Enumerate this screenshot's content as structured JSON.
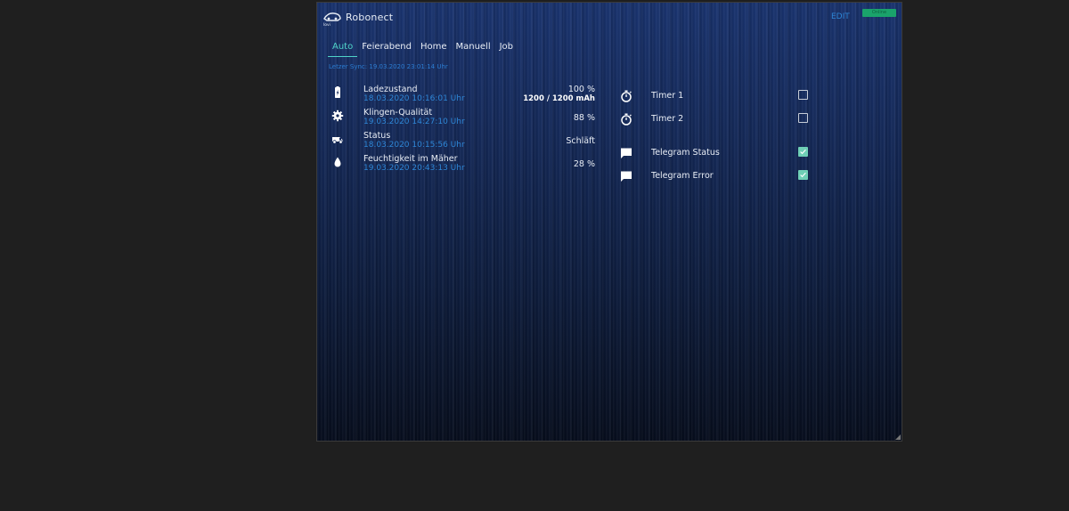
{
  "app": {
    "title": "Robonect",
    "logo_text": "lovi",
    "edit_label": "EDIT",
    "status_label": "Online",
    "status_color": "#1aa36b"
  },
  "tabs": [
    {
      "label": "Auto",
      "active": true
    },
    {
      "label": "Feierabend",
      "active": false
    },
    {
      "label": "Home",
      "active": false
    },
    {
      "label": "Manuell",
      "active": false
    },
    {
      "label": "Job",
      "active": false
    }
  ],
  "sync_text": "Letzer Sync: 19.03.2020 23:01:14 Uhr",
  "sensors": [
    {
      "icon": "battery-icon",
      "name": "Ladezustand",
      "timestamp": "18.03.2020 10:16:01 Uhr",
      "value": "100 %",
      "value2": "1200 / 1200 mAh"
    },
    {
      "icon": "gear-icon",
      "name": "Klingen-Qualität",
      "timestamp": "19.03.2020 14:27:10 Uhr",
      "value": "88 %",
      "value2": ""
    },
    {
      "icon": "mower-icon",
      "name": "Status",
      "timestamp": "18.03.2020 10:15:56 Uhr",
      "value": "Schläft",
      "value2": ""
    },
    {
      "icon": "water-drop-icon",
      "name": "Feuchtigkeit im Mäher",
      "timestamp": "19.03.2020 20:43:13 Uhr",
      "value": "28 %",
      "value2": ""
    }
  ],
  "toggles": [
    {
      "icon": "stopwatch-icon",
      "name": "Timer 1",
      "checked": false
    },
    {
      "icon": "stopwatch-icon",
      "name": "Timer 2",
      "checked": false
    },
    {
      "icon": "chat-icon",
      "name": "Telegram Status",
      "checked": true
    },
    {
      "icon": "chat-icon",
      "name": "Telegram Error",
      "checked": true
    }
  ],
  "colors": {
    "accent": "#4fd3c8",
    "link": "#2e86d6",
    "check": "#6fcfb6"
  }
}
